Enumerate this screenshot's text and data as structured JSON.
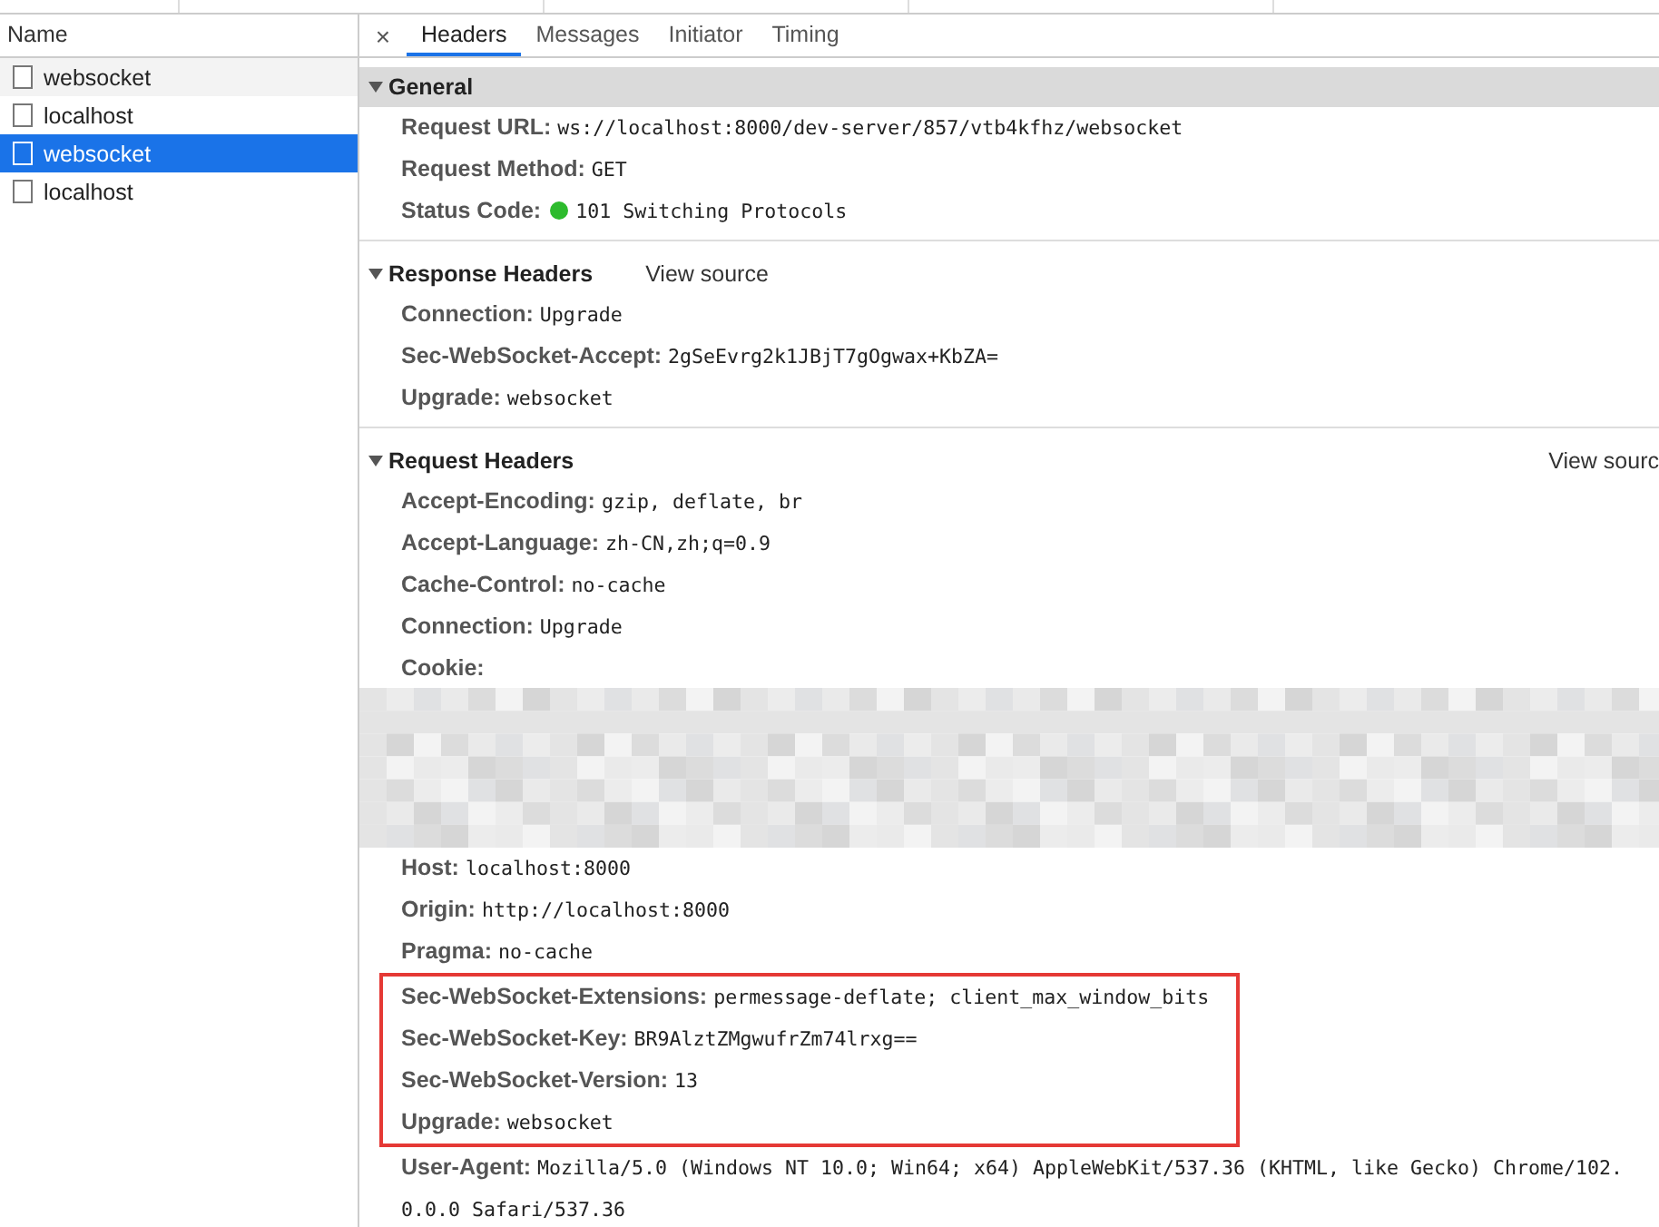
{
  "name_panel": {
    "header": "Name",
    "requests": [
      {
        "name": "websocket",
        "selected": false
      },
      {
        "name": "localhost",
        "selected": false
      },
      {
        "name": "websocket",
        "selected": true
      },
      {
        "name": "localhost",
        "selected": false
      }
    ]
  },
  "close": "×",
  "tabs": [
    {
      "label": "Headers",
      "selected": true
    },
    {
      "label": "Messages",
      "selected": false
    },
    {
      "label": "Initiator",
      "selected": false
    },
    {
      "label": "Timing",
      "selected": false
    }
  ],
  "sections": [
    {
      "title": "General",
      "focused": true,
      "expanded": true,
      "rows": [
        {
          "kind": "plain",
          "name": "Request URL:",
          "value": "ws://localhost:8000/dev-server/857/vtb4kfhz/websocket",
          "highlighted": false
        },
        {
          "kind": "plain",
          "name": "Request Method:",
          "value": "GET",
          "highlighted": false
        },
        {
          "kind": "status",
          "name": "Status Code:",
          "value": "101 Switching Protocols",
          "highlighted": false
        }
      ]
    },
    {
      "title": "Response Headers",
      "focused": false,
      "expanded": true,
      "view_source": "View source",
      "rows": [
        {
          "kind": "plain",
          "name": "Connection:",
          "value": "Upgrade",
          "highlighted": false
        },
        {
          "kind": "plain",
          "name": "Sec-WebSocket-Accept:",
          "value": "2gSeEvrg2k1JBjT7gOgwax+KbZA=",
          "highlighted": false
        },
        {
          "kind": "plain",
          "name": "Upgrade:",
          "value": "websocket",
          "highlighted": false
        }
      ]
    },
    {
      "title": "Request Headers",
      "focused": false,
      "expanded": true,
      "view_source": "View sourc",
      "rows": [
        {
          "kind": "plain",
          "name": "Accept-Encoding:",
          "value": "gzip, deflate, br",
          "highlighted": false
        },
        {
          "kind": "plain",
          "name": "Accept-Language:",
          "value": "zh-CN,zh;q=0.9",
          "highlighted": false
        },
        {
          "kind": "plain",
          "name": "Cache-Control:",
          "value": "no-cache",
          "highlighted": false
        },
        {
          "kind": "plain",
          "name": "Connection:",
          "value": "Upgrade",
          "highlighted": false
        },
        {
          "kind": "redacted",
          "name": "Cookie:",
          "highlighted": false
        },
        {
          "kind": "plain",
          "name": "Host:",
          "value": "localhost:8000",
          "highlighted": false
        },
        {
          "kind": "plain",
          "name": "Origin:",
          "value": "http://localhost:8000",
          "highlighted": false
        },
        {
          "kind": "plain",
          "name": "Pragma:",
          "value": "no-cache",
          "highlighted": false
        },
        {
          "kind": "plain",
          "name": "Sec-WebSocket-Extensions:",
          "value": "permessage-deflate; client_max_window_bits",
          "highlighted": true
        },
        {
          "kind": "plain",
          "name": "Sec-WebSocket-Key:",
          "value": "BR9AlztZMgwufrZm74lrxg==",
          "highlighted": true
        },
        {
          "kind": "plain",
          "name": "Sec-WebSocket-Version:",
          "value": "13",
          "highlighted": true
        },
        {
          "kind": "plain",
          "name": "Upgrade:",
          "value": "websocket",
          "highlighted": true
        },
        {
          "kind": "plain",
          "name": "User-Agent:",
          "value": "Mozilla/5.0 (Windows NT 10.0; Win64; x64) AppleWebKit/537.36 (KHTML, like Gecko) Chrome/102.0.0.0 Safari/537.36",
          "highlighted": false
        }
      ]
    }
  ]
}
